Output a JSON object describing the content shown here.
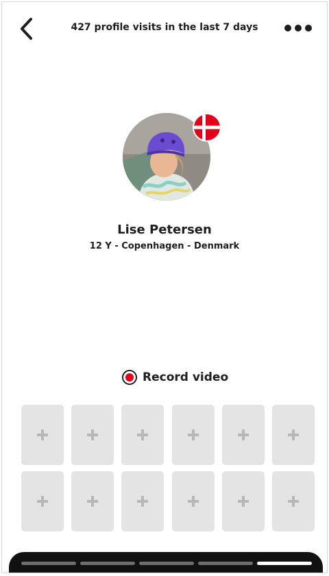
{
  "header": {
    "back_icon": "chevron-left-icon",
    "title": "427 profile visits in the last 7 days",
    "more_icon": "more-horizontal-icon"
  },
  "profile": {
    "flag": "denmark-flag",
    "flag_colors": {
      "red": "#e3001b",
      "white": "#ffffff"
    },
    "name": "Lise Petersen",
    "meta": "12 Y - Copenhagen - Denmark"
  },
  "record": {
    "icon": "record-icon",
    "label": "Record video",
    "accent": "#e3001b"
  },
  "video_slots": {
    "count": 12,
    "icon": "plus-icon"
  },
  "pager": {
    "segments": 5,
    "active_index": 4
  }
}
